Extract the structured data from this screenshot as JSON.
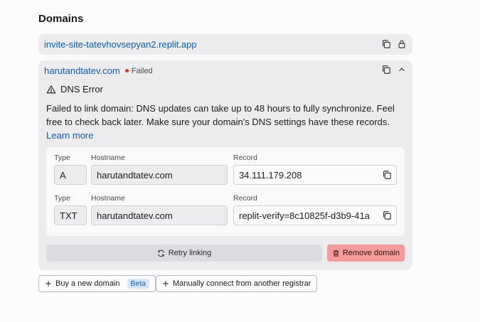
{
  "section": {
    "title": "Domains"
  },
  "site_domain": {
    "url": "invite-site-tatevhovsepyan2.replit.app"
  },
  "custom_domain": {
    "name": "harutandtatev.com",
    "status": "Failed",
    "error_title": "DNS Error",
    "error_message": "Failed to link domain: DNS updates can take up to 48 hours to fully synchronize. Feel free to check back later. Make sure your domain's DNS settings have these records.",
    "learn_more": "Learn more",
    "records": [
      {
        "type_label": "Type",
        "hostname_label": "Hostname",
        "record_label": "Record",
        "type": "A",
        "hostname": "harutandtatev.com",
        "record": "34.111.179.208"
      },
      {
        "type_label": "Type",
        "hostname_label": "Hostname",
        "record_label": "Record",
        "type": "TXT",
        "hostname": "harutandtatev.com",
        "record": "replit-verify=8c10825f-d3b9-41a"
      }
    ],
    "retry_label": "Retry linking",
    "remove_label": "Remove domain"
  },
  "actions": {
    "buy_label": "Buy a new domain",
    "buy_badge": "Beta",
    "connect_label": "Manually connect from another registrar"
  },
  "colors": {
    "link": "#0f5bb5",
    "failed": "#e0332a",
    "remove_bg": "#f59a9a"
  }
}
